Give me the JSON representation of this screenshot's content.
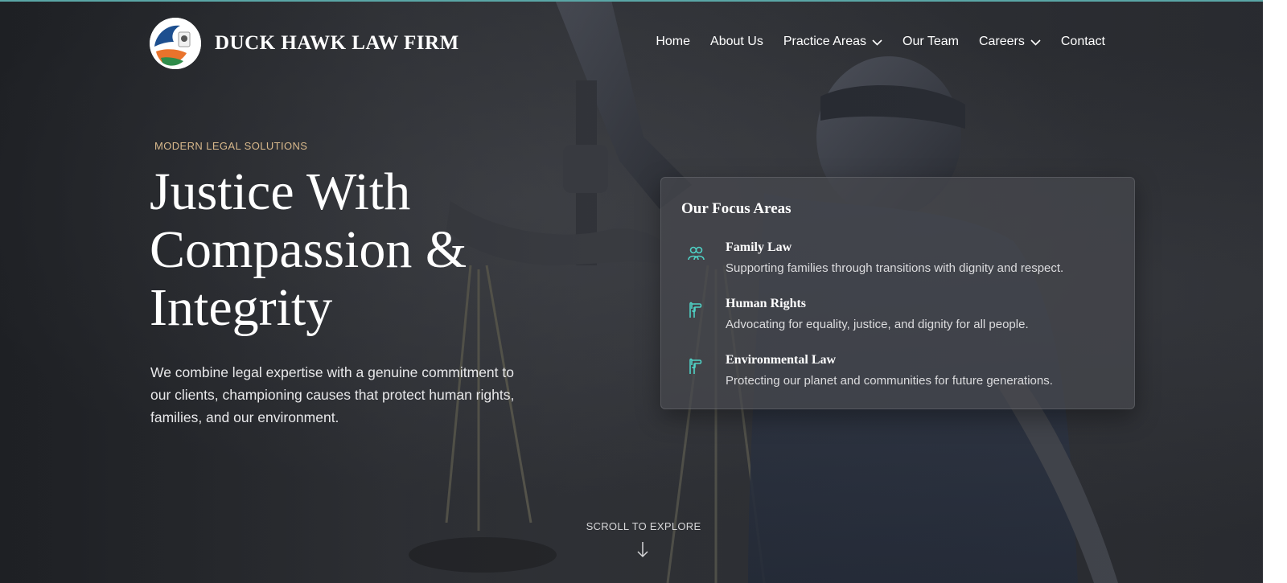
{
  "brand": {
    "name": "DUCK HAWK LAW FIRM",
    "logo_icon": "duck-hawk-logo"
  },
  "nav": {
    "items": [
      {
        "label": "Home",
        "has_dropdown": false
      },
      {
        "label": "About Us",
        "has_dropdown": false
      },
      {
        "label": "Practice Areas",
        "has_dropdown": true
      },
      {
        "label": "Our Team",
        "has_dropdown": false
      },
      {
        "label": "Careers",
        "has_dropdown": true
      },
      {
        "label": "Contact",
        "has_dropdown": false
      }
    ]
  },
  "hero": {
    "eyebrow": "MODERN LEGAL SOLUTIONS",
    "headline": "Justice With Compassion & Integrity",
    "lead": "We combine legal expertise with a genuine commitment to our clients, championing causes that protect human rights, families, and our environment."
  },
  "focus": {
    "title": "Our Focus Areas",
    "items": [
      {
        "name": "Family Law",
        "description": "Supporting families through transitions with dignity and respect.",
        "icon": "family-icon"
      },
      {
        "name": "Human Rights",
        "description": "Advocating for equality, justice, and dignity for all people.",
        "icon": "hand-raised-icon"
      },
      {
        "name": "Environmental Law",
        "description": "Protecting our planet and communities for future generations.",
        "icon": "hand-raised-icon"
      }
    ]
  },
  "scroll": {
    "label": "SCROLL TO EXPLORE",
    "icon": "arrow-down-icon"
  },
  "colors": {
    "accent_teal": "#4fd1c5",
    "eyebrow_gold": "#d9b98c"
  }
}
